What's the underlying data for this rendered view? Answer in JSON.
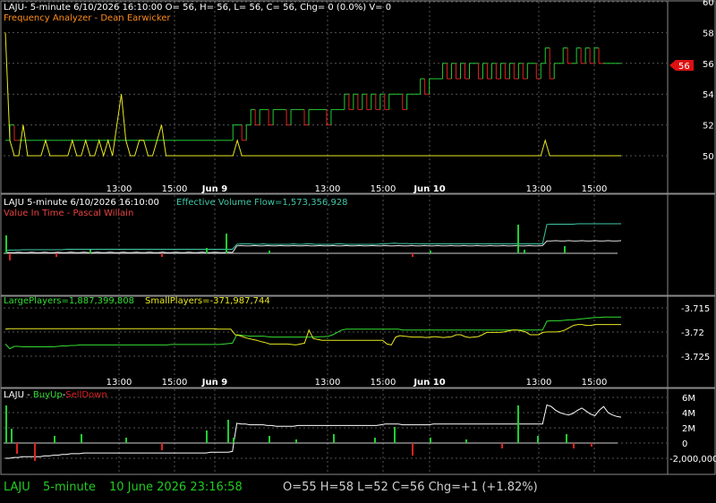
{
  "colors": {
    "background": "#000000",
    "grid": "#555555",
    "axis_text": "#ffffff",
    "up": "#22cc33",
    "down": "#dd2222",
    "yellow": "#e8e820",
    "teal": "#3fc8a8",
    "orange": "#ff8c1a",
    "green_text": "#33dd33",
    "white": "#ffffff",
    "status_green": "#22cc22",
    "status_gray": "#cfcfcf"
  },
  "panel1": {
    "header": "LAJU- 5-minute 6/10/2026 16:10:00 O= 56, H= 56, L= 56, C= 56, Chg= 0 (0.0%) V= 0",
    "subtitle": "Frequency Analyzer - Dean Earwicker",
    "price_badge": "56"
  },
  "panel2": {
    "header": "LAJU 5-minute  6/10/2026 16:10:00",
    "volume_flow": "Effective Volume Flow=1,573,356,928",
    "subtitle": "Value In Time - Pascal Willain"
  },
  "panel3": {
    "large_players": "LargePlayers=1,887,399,808",
    "small_players": "SmallPlayers=-371,987,744"
  },
  "panel4": {
    "header_prefix": "LAJU - ",
    "buy_up": "BuyUp",
    "dash": "-",
    "sell_down": "SellDown"
  },
  "status_bar": {
    "symbol": "LAJU",
    "interval": "5-minute",
    "datetime": "10 June 2026 23:16:58",
    "ohlc": "O=55  H=58  L=52  C=56  Chg=+1 (+1.82%)"
  },
  "chart_data": [
    {
      "type": "line",
      "title": "Frequency Analyzer - Dean Earwicker",
      "x_ticks": [
        "13:00",
        "15:00",
        "Jun 9",
        "13:00",
        "15:00",
        "Jun 10",
        "13:00",
        "15:00"
      ],
      "y_ticks": [
        "50",
        "52",
        "54",
        "56",
        "58",
        "60"
      ],
      "ylim": [
        49.5,
        60
      ],
      "series": [
        {
          "name": "price",
          "color_up": "#22cc33",
          "color_down": "#dd2222",
          "values": [
            51,
            51,
            52,
            51,
            51,
            51,
            51,
            51,
            51,
            51,
            51,
            51,
            51,
            51,
            51,
            51,
            51,
            51,
            51,
            51,
            51,
            51,
            51,
            51,
            51,
            51,
            51,
            51,
            51,
            51,
            51,
            51,
            51,
            51,
            51,
            51,
            51,
            51,
            51,
            51,
            51,
            51,
            51,
            51,
            51,
            51,
            51,
            51,
            51,
            51,
            51,
            51,
            52,
            52,
            51,
            52,
            53,
            52,
            53,
            53,
            52,
            53,
            53,
            53,
            52,
            53,
            53,
            53,
            52,
            53,
            53,
            53,
            53,
            52,
            53,
            53,
            53,
            54,
            53,
            54,
            53,
            54,
            53,
            54,
            53,
            54,
            53,
            54,
            54,
            54,
            53,
            54,
            54,
            54,
            55,
            54,
            55,
            55,
            55,
            56,
            55,
            56,
            55,
            56,
            55,
            56,
            56,
            55,
            56,
            55,
            56,
            55,
            56,
            55,
            56,
            55,
            56,
            55,
            56,
            56,
            55,
            56,
            57,
            55,
            56,
            56,
            57,
            56,
            56,
            57,
            56,
            57,
            56,
            57,
            56,
            56,
            56,
            56,
            56
          ]
        },
        {
          "name": "frequency",
          "color": "#e8e820",
          "values": [
            58,
            51,
            50,
            50,
            52,
            50,
            50,
            50,
            50,
            51,
            50,
            50,
            50,
            50,
            50,
            51,
            50,
            50,
            51,
            50,
            50,
            51,
            50,
            51,
            50,
            52,
            54,
            51,
            50,
            50,
            51,
            51,
            50,
            50,
            51,
            52,
            50,
            50,
            50,
            50,
            50,
            50,
            50,
            50,
            50,
            50,
            50,
            50,
            50,
            50,
            50,
            50,
            51,
            50,
            50,
            50,
            50,
            50,
            50,
            50,
            50,
            50,
            50,
            50,
            50,
            50,
            50,
            50,
            50,
            50,
            50,
            50,
            50,
            50,
            50,
            50,
            50,
            50,
            50,
            50,
            50,
            50,
            50,
            50,
            50,
            50,
            50,
            50,
            50,
            50,
            50,
            50,
            50,
            50,
            50,
            50,
            50,
            50,
            50,
            50,
            50,
            50,
            50,
            50,
            50,
            50,
            50,
            50,
            50,
            50,
            50,
            50,
            50,
            50,
            50,
            50,
            50,
            50,
            50,
            50,
            50,
            51,
            50,
            50,
            50,
            50,
            50,
            50,
            50,
            50,
            50,
            50,
            50,
            50,
            50,
            50,
            50,
            50,
            50
          ]
        }
      ]
    },
    {
      "type": "line",
      "title": "Value In Time - Pascal Willain",
      "x_ticks": [
        "13:00",
        "15:00",
        "Jun 9",
        "13:00",
        "15:00",
        "Jun 10",
        "13:00",
        "15:00"
      ],
      "series": [
        {
          "name": "Effective Volume Flow",
          "color": "#3fc8a8",
          "values": [
            0.35,
            0.36,
            0.36,
            0.36,
            0.37,
            0.37,
            0.37,
            0.37,
            0.37,
            0.37,
            0.37,
            0.37,
            0.37,
            0.37,
            0.38,
            0.38,
            0.38,
            0.38,
            0.38,
            0.38,
            0.38,
            0.38,
            0.38,
            0.38,
            0.38,
            0.38,
            0.38,
            0.38,
            0.38,
            0.38,
            0.38,
            0.38,
            0.38,
            0.38,
            0.38,
            0.38,
            0.38,
            0.38,
            0.38,
            0.38,
            0.38,
            0.38,
            0.38,
            0.38,
            0.38,
            0.38,
            0.38,
            0.38,
            0.38,
            0.38,
            0.38,
            0.38,
            0.38,
            0.5,
            0.51,
            0.51,
            0.51,
            0.5,
            0.5,
            0.51,
            0.5,
            0.5,
            0.5,
            0.5,
            0.5,
            0.5,
            0.51,
            0.5,
            0.5,
            0.51,
            0.51,
            0.5,
            0.5,
            0.5,
            0.5,
            0.5,
            0.51,
            0.51,
            0.5,
            0.5,
            0.5,
            0.5,
            0.5,
            0.5,
            0.5,
            0.5,
            0.51,
            0.51,
            0.52,
            0.53,
            0.52,
            0.52,
            0.52,
            0.51,
            0.52,
            0.51,
            0.51,
            0.51,
            0.51,
            0.51,
            0.51,
            0.51,
            0.51,
            0.51,
            0.51,
            0.51,
            0.51,
            0.51,
            0.51,
            0.51,
            0.51,
            0.51,
            0.51,
            0.51,
            0.51,
            0.51,
            0.51,
            0.51,
            0.51,
            0.51,
            0.51,
            0.51,
            0.51,
            0.51,
            0.98,
            0.99,
            0.99,
            0.99,
            0.99,
            0.99,
            0.99,
            1.0,
            1.0,
            1.0,
            1.0,
            1.0,
            1.0,
            1.0,
            1.0,
            1.0,
            1.0,
            1.0
          ]
        }
      ]
    },
    {
      "type": "line",
      "title": "LargePlayers / SmallPlayers",
      "x_ticks": [
        "13:00",
        "15:00",
        "Jun 9",
        "13:00",
        "15:00",
        "Jun 10",
        "13:00",
        "15:00"
      ],
      "y_ticks": [
        "-3.715",
        "-3.72",
        "-3.725"
      ],
      "series": [
        {
          "name": "LargePlayers",
          "color": "#33dd33",
          "values": [
            0.3,
            0.2,
            0.25,
            0.25,
            0.24,
            0.24,
            0.24,
            0.24,
            0.24,
            0.24,
            0.24,
            0.24,
            0.25,
            0.26,
            0.26,
            0.27,
            0.27,
            0.28,
            0.28,
            0.28,
            0.28,
            0.28,
            0.28,
            0.28,
            0.28,
            0.28,
            0.28,
            0.28,
            0.28,
            0.28,
            0.28,
            0.28,
            0.28,
            0.28,
            0.28,
            0.28,
            0.28,
            0.28,
            0.29,
            0.29,
            0.29,
            0.29,
            0.29,
            0.29,
            0.29,
            0.29,
            0.29,
            0.29,
            0.29,
            0.29,
            0.3,
            0.31,
            0.32,
            0.5,
            0.49,
            0.48,
            0.47,
            0.47,
            0.47,
            0.47,
            0.46,
            0.45,
            0.45,
            0.45,
            0.45,
            0.45,
            0.45,
            0.45,
            0.45,
            0.45,
            0.45,
            0.45,
            0.46,
            0.46,
            0.47,
            0.5,
            0.55,
            0.6,
            0.62,
            0.62,
            0.62,
            0.62,
            0.62,
            0.62,
            0.62,
            0.62,
            0.62,
            0.62,
            0.62,
            0.62,
            0.62,
            0.6,
            0.6,
            0.6,
            0.6,
            0.6,
            0.6,
            0.6,
            0.6,
            0.6,
            0.6,
            0.6,
            0.6,
            0.6,
            0.6,
            0.6,
            0.6,
            0.6,
            0.6,
            0.6,
            0.6,
            0.6,
            0.6,
            0.6,
            0.6,
            0.6,
            0.6,
            0.6,
            0.6,
            0.6,
            0.6,
            0.6,
            0.6,
            0.6,
            0.79,
            0.8,
            0.8,
            0.8,
            0.81,
            0.82,
            0.82,
            0.83,
            0.84,
            0.85,
            0.86,
            0.87,
            0.87,
            0.88,
            0.88,
            0.88,
            0.88,
            0.88
          ]
        },
        {
          "name": "SmallPlayers",
          "color": "#e8e820",
          "values": [
            0.62,
            0.63,
            0.63,
            0.63,
            0.63,
            0.63,
            0.63,
            0.63,
            0.63,
            0.63,
            0.63,
            0.63,
            0.63,
            0.63,
            0.63,
            0.63,
            0.63,
            0.63,
            0.63,
            0.63,
            0.63,
            0.63,
            0.63,
            0.63,
            0.63,
            0.63,
            0.63,
            0.63,
            0.63,
            0.63,
            0.63,
            0.63,
            0.63,
            0.63,
            0.63,
            0.63,
            0.63,
            0.63,
            0.63,
            0.63,
            0.63,
            0.63,
            0.63,
            0.63,
            0.63,
            0.63,
            0.63,
            0.63,
            0.63,
            0.62,
            0.62,
            0.62,
            0.62,
            0.5,
            0.48,
            0.45,
            0.42,
            0.4,
            0.38,
            0.35,
            0.33,
            0.3,
            0.3,
            0.3,
            0.3,
            0.3,
            0.29,
            0.28,
            0.3,
            0.32,
            0.6,
            0.42,
            0.4,
            0.38,
            0.38,
            0.38,
            0.38,
            0.38,
            0.38,
            0.38,
            0.38,
            0.38,
            0.38,
            0.38,
            0.38,
            0.38,
            0.38,
            0.38,
            0.3,
            0.28,
            0.45,
            0.48,
            0.47,
            0.46,
            0.45,
            0.45,
            0.45,
            0.44,
            0.45,
            0.46,
            0.45,
            0.44,
            0.45,
            0.46,
            0.5,
            0.5,
            0.46,
            0.44,
            0.45,
            0.46,
            0.5,
            0.55,
            0.55,
            0.55,
            0.55,
            0.56,
            0.58,
            0.6,
            0.6,
            0.58,
            0.56,
            0.5,
            0.5,
            0.5,
            0.55,
            0.56,
            0.56,
            0.56,
            0.57,
            0.6,
            0.65,
            0.7,
            0.72,
            0.72,
            0.7,
            0.7,
            0.72,
            0.72,
            0.72,
            0.72,
            0.72,
            0.72,
            0.72
          ]
        }
      ]
    },
    {
      "type": "line",
      "title": "BuyUp-SellDown",
      "x_ticks": [
        "13:00",
        "15:00",
        "Jun 9",
        "13:00",
        "15:00",
        "Jun 10",
        "13:00",
        "15:00"
      ],
      "y_ticks": [
        "6M",
        "4M",
        "2M",
        "0",
        "-2,000,000"
      ],
      "ylim": [
        -3000000,
        6500000
      ],
      "series": [
        {
          "name": "line",
          "color": "#ffffff",
          "values": [
            -2000000,
            -2000000,
            -1900000,
            -1900000,
            -1800000,
            -1800000,
            -1800000,
            -1800000,
            -1800000,
            -1700000,
            -1700000,
            -1600000,
            -1600000,
            -1500000,
            -1500000,
            -1400000,
            -1400000,
            -1400000,
            -1300000,
            -1300000,
            -1300000,
            -1300000,
            -1300000,
            -1300000,
            -1300000,
            -1300000,
            -1300000,
            -1300000,
            -1300000,
            -1300000,
            -1300000,
            -1300000,
            -1300000,
            -1300000,
            -1300000,
            -1300000,
            -1300000,
            -1300000,
            -1300000,
            -1300000,
            -1300000,
            -1300000,
            -1300000,
            -1300000,
            -1300000,
            -1300000,
            -1300000,
            -1200000,
            -1200000,
            -1200000,
            -1200000,
            -1200000,
            -1100000,
            2600000,
            2500000,
            2500000,
            2400000,
            2400000,
            2400000,
            2400000,
            2300000,
            2300000,
            2200000,
            2200000,
            2200000,
            2200000,
            2200000,
            2300000,
            2300000,
            2300000,
            2300000,
            2300000,
            2300000,
            2300000,
            2300000,
            2300000,
            2300000,
            2300000,
            2300000,
            2300000,
            2300000,
            2300000,
            2300000,
            2300000,
            2300000,
            2300000,
            2400000,
            2500000,
            2500000,
            2500000,
            2500000,
            2400000,
            2400000,
            2400000,
            2400000,
            2400000,
            2400000,
            2400000,
            2500000,
            2500000,
            2500000,
            2500000,
            2500000,
            2500000,
            2500000,
            2500000,
            2500000,
            2500000,
            2500000,
            2500000,
            2500000,
            2500000,
            2500000,
            2500000,
            2500000,
            2500000,
            2500000,
            2500000,
            2500000,
            2500000,
            2500000,
            2500000,
            2500000,
            2500000,
            5000000,
            4800000,
            4300000,
            4000000,
            3800000,
            3700000,
            3900000,
            4300000,
            4600000,
            4200000,
            3800000,
            3600000,
            4300000,
            4800000,
            4000000,
            3700000,
            3500000,
            3400000
          ]
        }
      ]
    }
  ]
}
